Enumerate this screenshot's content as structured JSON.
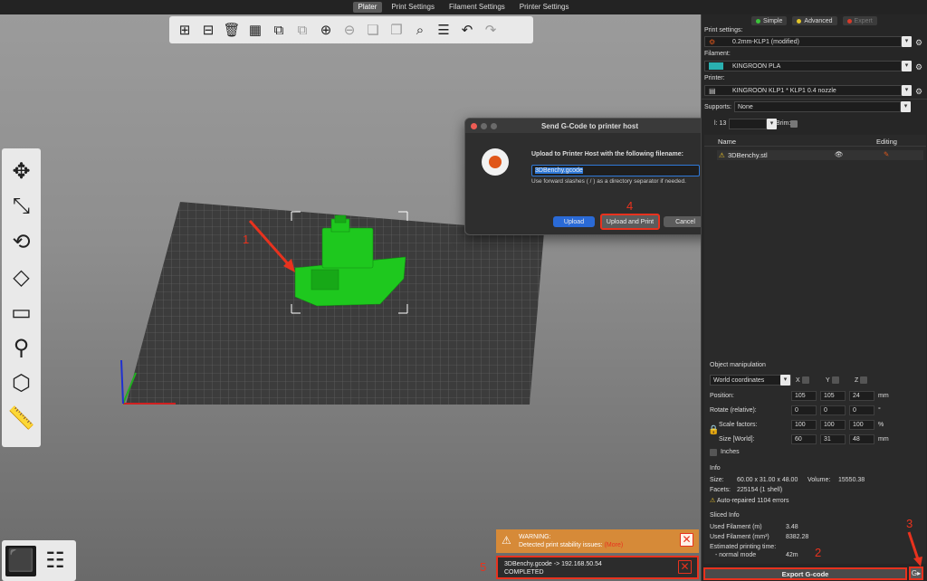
{
  "tabs": [
    {
      "label": "Plater",
      "active": true
    },
    {
      "label": "Print Settings",
      "active": false
    },
    {
      "label": "Filament Settings",
      "active": false
    },
    {
      "label": "Printer Settings",
      "active": false
    }
  ],
  "toolbar_icons": [
    "add-icon",
    "delete-icon",
    "delete-all-icon",
    "arrange-icon",
    "copy-icon",
    "paste-icon",
    "add-instance-icon",
    "remove-instance-icon",
    "split-objects-icon",
    "split-parts-icon",
    "search-icon",
    "layers-icon",
    "undo-icon",
    "redo-icon"
  ],
  "left_tools": [
    "move-icon",
    "scale-icon",
    "rotate-icon",
    "place-on-face-icon",
    "cut-icon",
    "paint-supports-icon",
    "seam-painting-icon",
    "measure-icon"
  ],
  "annotations": {
    "a1": "1",
    "a2": "2",
    "a3": "3",
    "a4": "4",
    "a5": "5"
  },
  "dialog": {
    "title": "Send G-Code to printer host",
    "message": "Upload to Printer Host with the following filename:",
    "filename": "3DBenchy.gcode",
    "hint": "Use forward slashes ( / ) as a directory separator if needed.",
    "btn_upload": "Upload",
    "btn_upload_print": "Upload and Print",
    "btn_cancel": "Cancel"
  },
  "notifications": {
    "warning_title": "WARNING:",
    "warning_text": "Detected print stability issues:",
    "warning_link": "(More)",
    "done_line1": "3DBenchy.gcode -> 192.168.50.54",
    "done_line2": "COMPLETED"
  },
  "panel": {
    "modes": [
      {
        "label": "Simple",
        "color": "#3bc43b"
      },
      {
        "label": "Advanced",
        "color": "#e2c52a"
      },
      {
        "label": "Expert",
        "color": "#d83a2a"
      }
    ],
    "print_settings_label": "Print settings:",
    "print_settings_value": "0.2mm-KLP1 (modified)",
    "filament_label": "Filament:",
    "filament_value": "KINGROON PLA",
    "filament_color": "#2ab0b0",
    "printer_label": "Printer:",
    "printer_value": "KINGROON KLP1 * KLP1 0.4 nozzle",
    "supports_label": "Supports:",
    "supports_value": "None",
    "infill_label": "l: 13",
    "brim_label": "Brim:",
    "col_name": "Name",
    "col_editing": "Editing",
    "object_name": "3DBenchy.stl",
    "objman_title": "Object manipulation",
    "coords": "World coordinates",
    "ax_x": "X",
    "ax_y": "Y",
    "ax_z": "Z",
    "position_label": "Position:",
    "position": [
      "105",
      "105",
      "24"
    ],
    "mm1": "mm",
    "rotate_label": "Rotate (relative):",
    "rotate": [
      "0",
      "0",
      "0"
    ],
    "deg": "°",
    "scale_label": "Scale factors:",
    "scale": [
      "100",
      "100",
      "100"
    ],
    "pct": "%",
    "size_label": "Size [World]:",
    "size": [
      "60",
      "31",
      "48"
    ],
    "mm2": "mm",
    "inches_label": "Inches",
    "info_title": "Info",
    "size_info_label": "Size:",
    "size_info": "60.00 x 31.00 x 48.00",
    "volume_label": "Volume:",
    "volume": "15550.38",
    "facets_label": "Facets:",
    "facets": "225154 (1 shell)",
    "repaired": "Auto-repaired 1104 errors",
    "sliced_title": "Sliced Info",
    "used_m_label": "Used Filament (m)",
    "used_m": "3.48",
    "used_mm3_label": "Used Filament (mm³)",
    "used_mm3": "8382.28",
    "est_label": "Estimated printing time:",
    "normal_label": "- normal mode",
    "normal_time": "42m",
    "export_label": "Export G-code"
  }
}
